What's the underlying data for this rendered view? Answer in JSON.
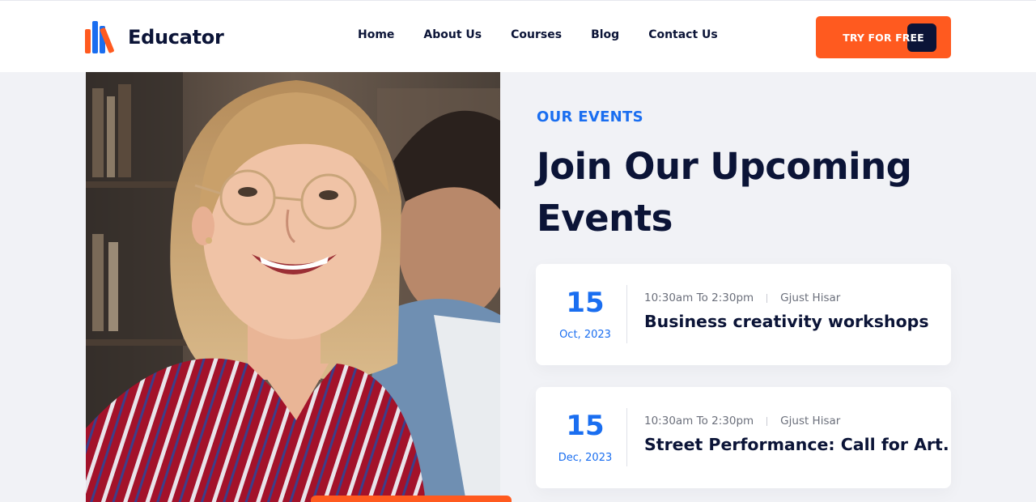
{
  "brand": {
    "name": "Educator"
  },
  "nav": {
    "items": [
      "Home",
      "About Us",
      "Courses",
      "Blog",
      "Contact Us"
    ]
  },
  "cta": {
    "label": "TRY FOR FREE"
  },
  "section": {
    "eyebrow": "OUR EVENTS",
    "headline": "Join Our Upcoming Events"
  },
  "events": [
    {
      "day": "15",
      "month": "Oct, 2023",
      "time": "10:30am To 2:30pm",
      "location": "Gjust Hisar",
      "title": "Business creativity workshops"
    },
    {
      "day": "15",
      "month": "Dec, 2023",
      "time": "10:30am To 2:30pm",
      "location": "Gjust Hisar",
      "title": "Street Performance: Call for Art."
    }
  ],
  "colors": {
    "accent_orange": "#ff5a1f",
    "accent_blue": "#1a6ef0",
    "navy": "#0b1437",
    "page_bg": "#f1f2f6"
  }
}
